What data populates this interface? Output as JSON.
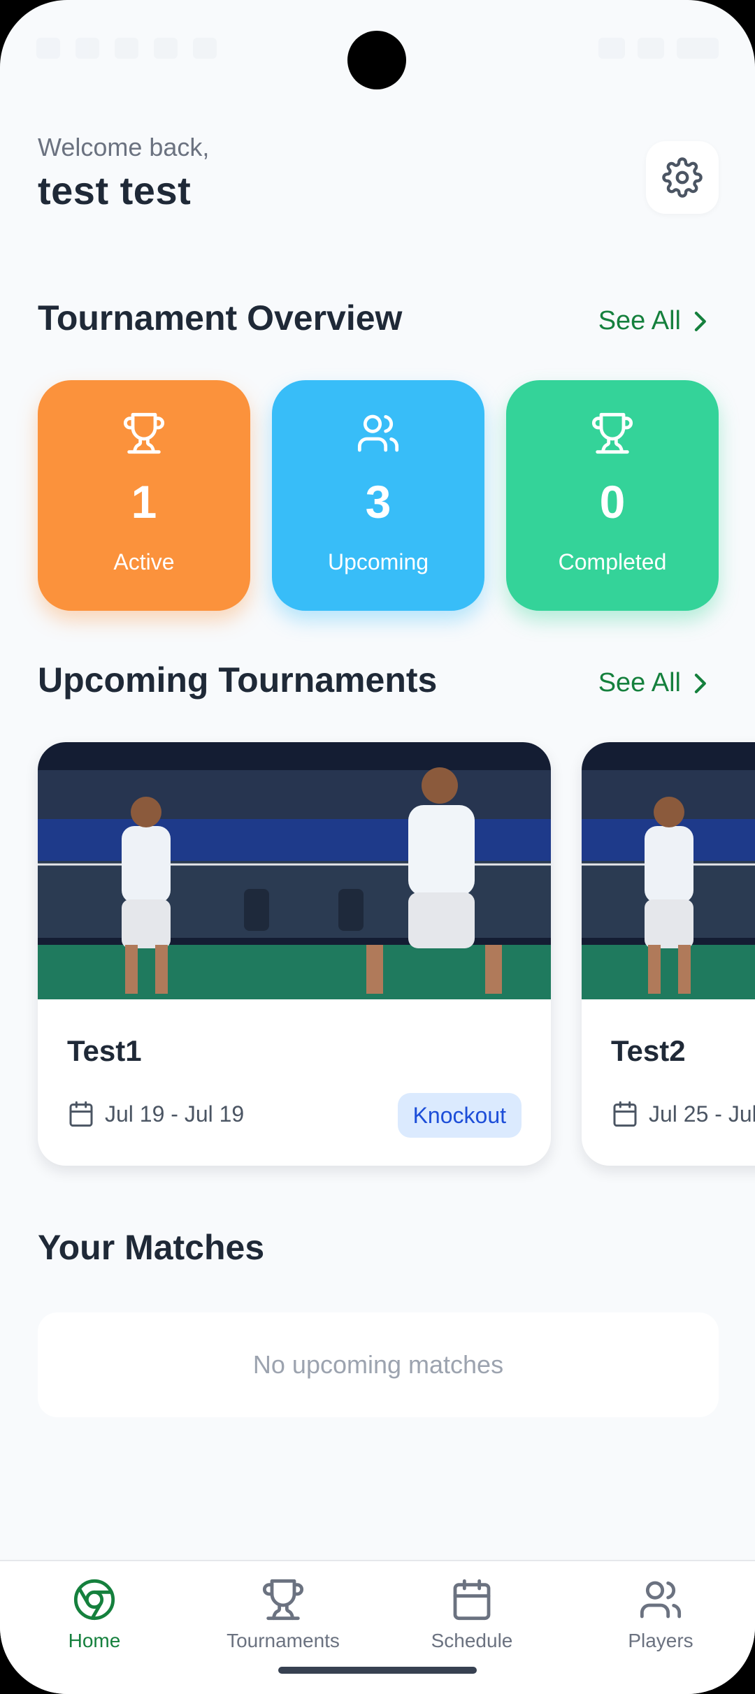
{
  "header": {
    "welcome": "Welcome back,",
    "username": "test test",
    "settings_icon": "gear-icon"
  },
  "overview": {
    "title": "Tournament Overview",
    "see_all": "See All",
    "cards": [
      {
        "value": "1",
        "label": "Active",
        "icon": "trophy-icon",
        "color": "#fb923c"
      },
      {
        "value": "3",
        "label": "Upcoming",
        "icon": "users-icon",
        "color": "#38bdf8"
      },
      {
        "value": "0",
        "label": "Completed",
        "icon": "trophy-icon",
        "color": "#34d399"
      }
    ]
  },
  "upcoming": {
    "title": "Upcoming Tournaments",
    "see_all": "See All",
    "tournaments": [
      {
        "name": "Test1",
        "dates": "Jul 19 - Jul 19",
        "format": "Knockout"
      },
      {
        "name": "Test2",
        "dates": "Jul 25 - Jul"
      }
    ]
  },
  "matches": {
    "title": "Your Matches",
    "empty": "No upcoming matches"
  },
  "nav": {
    "items": [
      {
        "label": "Home",
        "icon": "home-icon",
        "active": true
      },
      {
        "label": "Tournaments",
        "icon": "trophy-icon",
        "active": false
      },
      {
        "label": "Schedule",
        "icon": "calendar-icon",
        "active": false
      },
      {
        "label": "Players",
        "icon": "users-icon",
        "active": false
      }
    ]
  },
  "colors": {
    "accent": "#15803d",
    "text": "#1f2937",
    "badge_bg": "#dbeafe",
    "badge_text": "#1d4ed8"
  }
}
